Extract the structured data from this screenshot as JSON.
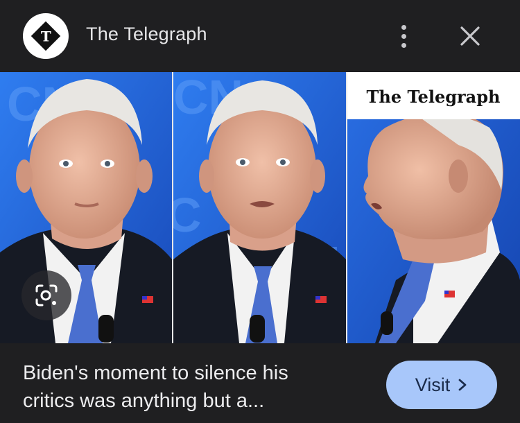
{
  "header": {
    "logo_letter": "T",
    "source_name": "The Telegraph",
    "more_icon": "more-vert-icon",
    "close_icon": "close-icon"
  },
  "image": {
    "watermark": "The Telegraph",
    "backdrop_text": "CNN",
    "colors": {
      "backdrop": "#1f5fd6",
      "suit": "#161a24",
      "tie": "#4a6fcf",
      "shirt": "#f2f2f2"
    }
  },
  "lens_icon": "google-lens-icon",
  "caption": {
    "line1": "Biden's moment to silence his",
    "line2": "critics was anything but a..."
  },
  "visit": {
    "label": "Visit",
    "icon": "chevron-right-icon"
  },
  "colors": {
    "background": "#1f1f21",
    "accent": "#a8c7fa",
    "text": "#e8e8ea"
  }
}
